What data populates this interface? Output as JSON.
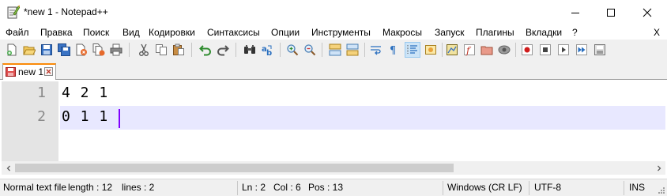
{
  "window": {
    "title": "*new 1 - Notepad++"
  },
  "menu": {
    "items": [
      {
        "label": "Файл"
      },
      {
        "label": "Правка"
      },
      {
        "label": "Поиск"
      },
      {
        "label": "Вид"
      },
      {
        "label": "Кодировки"
      },
      {
        "label": "Синтаксисы"
      },
      {
        "label": "Опции"
      },
      {
        "label": "Инструменты"
      },
      {
        "label": "Макросы"
      },
      {
        "label": "Запуск"
      },
      {
        "label": "Плагины"
      },
      {
        "label": "Вкладки"
      },
      {
        "label": "?"
      }
    ],
    "close_label": "X"
  },
  "toolbar": {
    "buttons": [
      "new-file-icon",
      "open-file-icon",
      "save-icon",
      "save-all-icon",
      "close-icon",
      "close-all-icon",
      "print-icon",
      "cut-icon",
      "copy-icon",
      "paste-icon",
      "undo-icon",
      "redo-icon",
      "find-icon",
      "replace-icon",
      "zoom-in-icon",
      "zoom-out-icon",
      "sync-vertical-icon",
      "sync-horizontal-icon",
      "word-wrap-icon",
      "show-all-chars-icon",
      "indent-guide-icon",
      "user-language-icon",
      "document-map-icon",
      "function-list-icon",
      "folder-workspace-icon",
      "monitoring-icon",
      "record-macro-icon",
      "stop-record-icon",
      "play-macro-icon",
      "run-macro-multiple-icon",
      "save-macro-icon"
    ],
    "active_button": "indent-guide-icon"
  },
  "tabs": [
    {
      "label": "new 1",
      "unsaved": true
    }
  ],
  "editor": {
    "lines": [
      {
        "number": "1",
        "text": "4 2 1"
      },
      {
        "number": "2",
        "text": "0 1 1"
      }
    ],
    "current_line": 2
  },
  "status": {
    "file_type": "Normal text file",
    "length": "length : 12",
    "lines": "lines : 2",
    "ln": "Ln : 2",
    "col": "Col : 6",
    "pos": "Pos : 13",
    "eol": "Windows (CR LF)",
    "encoding": "UTF-8",
    "mode": "INS"
  },
  "colors": {
    "current_line": "#e8e8ff",
    "caret": "#8000ff",
    "tab_accent": "#fa8a0a"
  }
}
